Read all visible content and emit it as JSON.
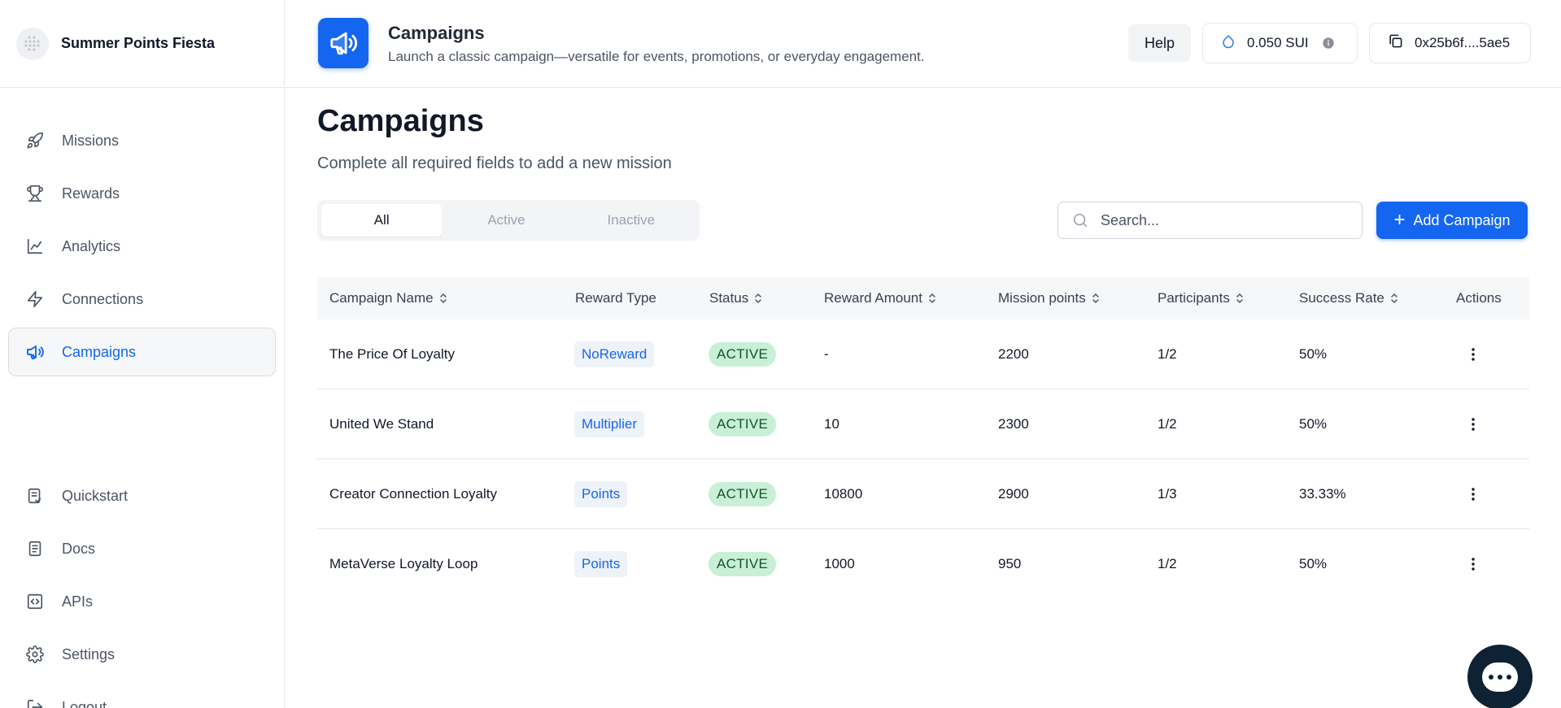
{
  "app": {
    "name": "Summer Points Fiesta"
  },
  "sidebar": {
    "top_items": [
      {
        "label": "Missions",
        "icon": "rocket-icon"
      },
      {
        "label": "Rewards",
        "icon": "trophy-icon"
      },
      {
        "label": "Analytics",
        "icon": "chart-line-icon"
      },
      {
        "label": "Connections",
        "icon": "lightning-icon"
      },
      {
        "label": "Campaigns",
        "icon": "megaphone-icon",
        "active": true
      }
    ],
    "bottom_items": [
      {
        "label": "Quickstart",
        "icon": "checklist-icon"
      },
      {
        "label": "Docs",
        "icon": "document-icon"
      },
      {
        "label": "APIs",
        "icon": "code-icon"
      },
      {
        "label": "Settings",
        "icon": "gear-icon"
      },
      {
        "label": "Logout",
        "icon": "logout-icon"
      }
    ]
  },
  "header": {
    "title": "Campaigns",
    "subtitle": "Launch a classic campaign—versatile for events, promotions, or everyday engagement.",
    "help_label": "Help",
    "balance": "0.050 SUI",
    "wallet": "0x25b6f....5ae5"
  },
  "main": {
    "title": "Campaigns",
    "subtitle": "Complete all required fields to add a new mission",
    "tabs": [
      {
        "label": "All",
        "active": true
      },
      {
        "label": "Active"
      },
      {
        "label": "Inactive"
      }
    ],
    "search_placeholder": "Search...",
    "add_label": "Add Campaign"
  },
  "table": {
    "columns": [
      "Campaign Name",
      "Reward Type",
      "Status",
      "Reward Amount",
      "Mission points",
      "Participants",
      "Success Rate",
      "Actions"
    ],
    "rows": [
      {
        "name": "The Price Of Loyalty",
        "reward_type": "NoReward",
        "status": "ACTIVE",
        "reward_amount": "-",
        "mission_points": "2200",
        "participants": "1/2",
        "success_rate": "50%"
      },
      {
        "name": "United We Stand",
        "reward_type": "Multiplier",
        "status": "ACTIVE",
        "reward_amount": "10",
        "mission_points": "2300",
        "participants": "1/2",
        "success_rate": "50%"
      },
      {
        "name": "Creator Connection Loyalty",
        "reward_type": "Points",
        "status": "ACTIVE",
        "reward_amount": "10800",
        "mission_points": "2900",
        "participants": "1/3",
        "success_rate": "33.33%"
      },
      {
        "name": "MetaVerse Loyalty Loop",
        "reward_type": "Points",
        "status": "ACTIVE",
        "reward_amount": "1000",
        "mission_points": "950",
        "participants": "1/2",
        "success_rate": "50%"
      }
    ]
  },
  "colors": {
    "accent": "#1466f0",
    "status_bg": "#c9f0d6",
    "reward_badge_bg": "#eef2f9"
  }
}
